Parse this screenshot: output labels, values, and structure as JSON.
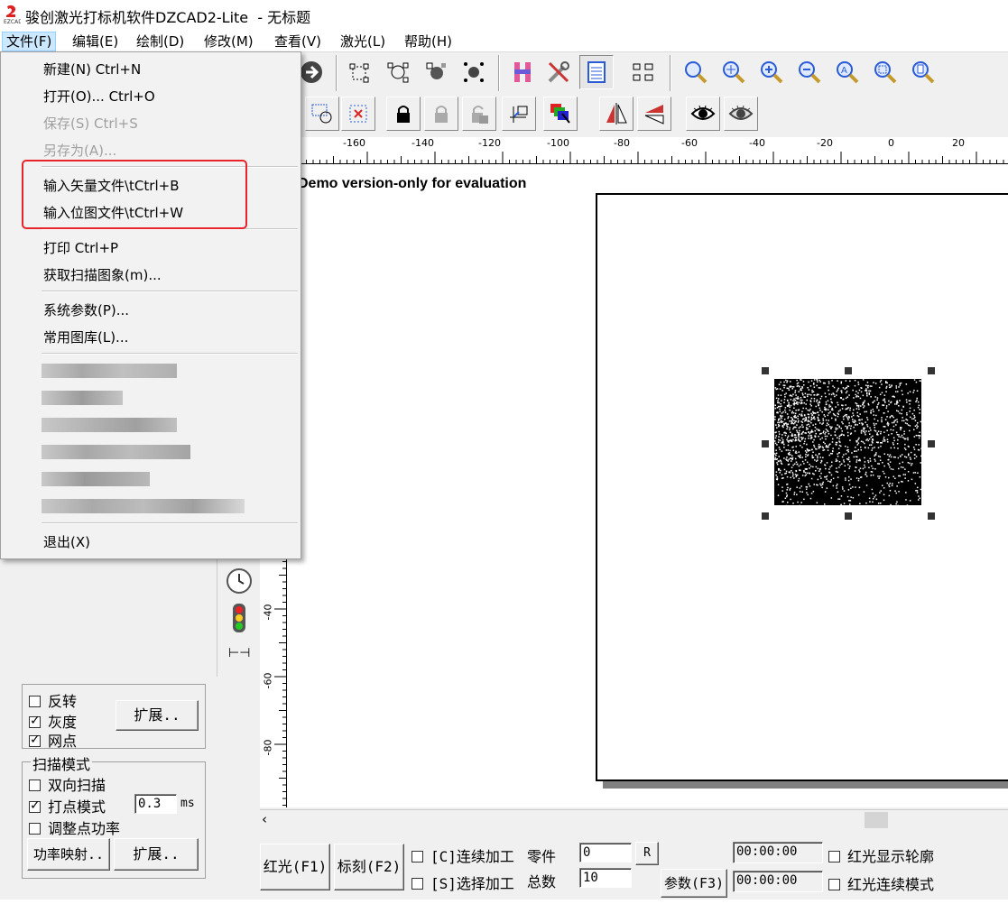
{
  "window": {
    "title": "骏创激光打标机软件DZCAD2-Lite  - 无标题"
  },
  "menubar": [
    {
      "label": "文件(F)"
    },
    {
      "label": "编辑(E)"
    },
    {
      "label": "绘制(D)"
    },
    {
      "label": "修改(M)"
    },
    {
      "label": "查看(V)"
    },
    {
      "label": "激光(L)"
    },
    {
      "label": "帮助(H)"
    }
  ],
  "file_menu": {
    "new": "新建(N) Ctrl+N",
    "open": "打开(O)... Ctrl+O",
    "save": "保存(S) Ctrl+S",
    "save_as": "另存为(A)...",
    "import_vector": "输入矢量文件\\tCtrl+B",
    "import_bitmap": "输入位图文件\\tCtrl+W",
    "print": "打印 Ctrl+P",
    "acquire_scan": "获取扫描图象(m)...",
    "system_params": "系统参数(P)...",
    "library": "常用图库(L)...",
    "exit": "退出(X)"
  },
  "ruler": {
    "h_labels": [
      "-160",
      "-140",
      "-120",
      "-100",
      "-80",
      "-60",
      "-40",
      "-20",
      "0",
      "20"
    ],
    "v_labels": [
      "-40",
      "-60",
      "-80"
    ]
  },
  "canvas": {
    "watermark": "Demo version-only for evaluation"
  },
  "left_panel": {
    "invert": "反转",
    "grayscale": "灰度",
    "dither": "网点",
    "extend1": "扩展..",
    "scan_mode_title": "扫描模式",
    "bidirectional": "双向扫描",
    "dot_mode": "打点模式",
    "dot_time": "0.3",
    "dot_unit": "ms",
    "adjust_power": "调整点功率",
    "power_map": "功率映射..",
    "extend2": "扩展.."
  },
  "bottom": {
    "red_light": "红光(F1)",
    "mark": "标刻(F2)",
    "continuous": "[C]连续加工",
    "selected": "[S]选择加工",
    "parts_label": "零件",
    "parts_value": "0",
    "reset": "R",
    "total_label": "总数",
    "total_value": "10",
    "params": "参数(F3)",
    "time1": "00:00:00",
    "time2": "00:00:00",
    "red_outline": "红光显示轮廓",
    "red_continuous": "红光连续模式"
  },
  "colors": {
    "highlight_box": "#e8232a",
    "menu_active": "#cce8ff"
  }
}
